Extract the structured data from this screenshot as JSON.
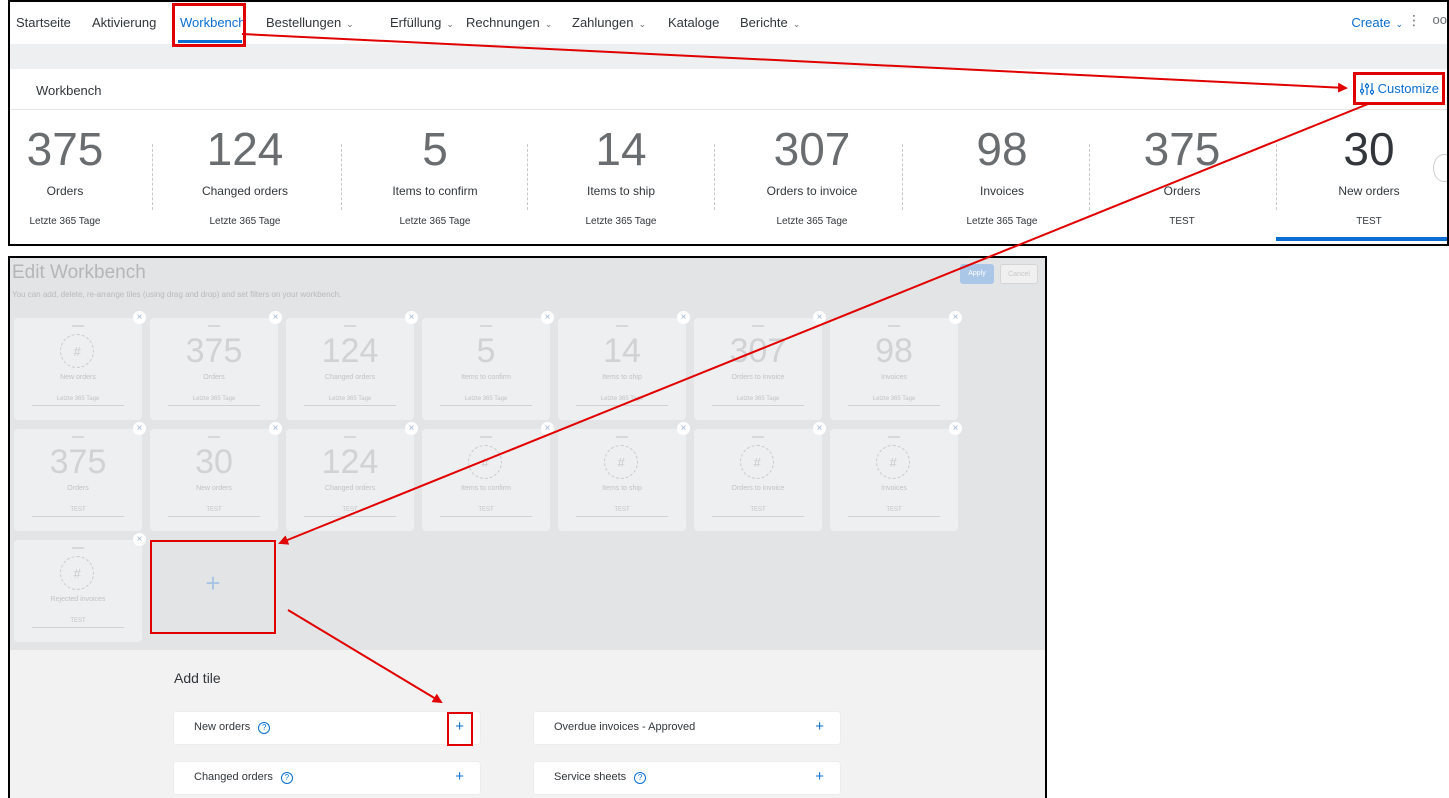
{
  "nav": {
    "items": [
      {
        "label": "Startseite",
        "dropdown": false
      },
      {
        "label": "Aktivierung",
        "dropdown": false
      },
      {
        "label": "Workbench",
        "dropdown": false,
        "active": true
      },
      {
        "label": "Bestellungen",
        "dropdown": true
      },
      {
        "label": "Erfüllung",
        "dropdown": true
      },
      {
        "label": "Rechnungen",
        "dropdown": true
      },
      {
        "label": "Zahlungen",
        "dropdown": true
      },
      {
        "label": "Kataloge",
        "dropdown": false
      },
      {
        "label": "Berichte",
        "dropdown": true
      }
    ],
    "create_label": "Create",
    "more_label": "oo"
  },
  "workbench": {
    "title": "Workbench",
    "customize_label": "Customize",
    "tiles": [
      {
        "count": "375",
        "label": "Orders",
        "period": "Letzte 365 Tage"
      },
      {
        "count": "124",
        "label": "Changed orders",
        "period": "Letzte 365 Tage"
      },
      {
        "count": "5",
        "label": "Items to confirm",
        "period": "Letzte 365 Tage"
      },
      {
        "count": "14",
        "label": "Items to ship",
        "period": "Letzte 365 Tage"
      },
      {
        "count": "307",
        "label": "Orders to invoice",
        "period": "Letzte 365 Tage"
      },
      {
        "count": "98",
        "label": "Invoices",
        "period": "Letzte 365 Tage"
      },
      {
        "count": "375",
        "label": "Orders",
        "period": "TEST"
      },
      {
        "count": "30",
        "label": "New orders",
        "period": "TEST",
        "selected": true
      }
    ]
  },
  "edit": {
    "title": "Edit Workbench",
    "description": "You can add, delete, re-arrange tiles (using drag and drop) and set filters on your workbench.",
    "apply_label": "Apply",
    "cancel_label": "Cancel",
    "placeholder_glyph": "#",
    "close_glyph": "×",
    "add_glyph": "+",
    "tiles_row1": [
      {
        "count": "",
        "label": "New orders",
        "period": "Letzte 365 Tage"
      },
      {
        "count": "375",
        "label": "Orders",
        "period": "Letzte 365 Tage"
      },
      {
        "count": "124",
        "label": "Changed orders",
        "period": "Letzte 365 Tage"
      },
      {
        "count": "5",
        "label": "Items to confirm",
        "period": "Letzte 365 Tage"
      },
      {
        "count": "14",
        "label": "Items to ship",
        "period": "Letzte 365 Tage"
      },
      {
        "count": "307",
        "label": "Orders to invoice",
        "period": "Letzte 365 Tage"
      },
      {
        "count": "98",
        "label": "Invoices",
        "period": "Letzte 365 Tage"
      }
    ],
    "tiles_row2": [
      {
        "count": "375",
        "label": "Orders",
        "period": "TEST"
      },
      {
        "count": "30",
        "label": "New orders",
        "period": "TEST"
      },
      {
        "count": "124",
        "label": "Changed orders",
        "period": "TEST"
      },
      {
        "count": "",
        "label": "Items to confirm",
        "period": "TEST"
      },
      {
        "count": "",
        "label": "Items to ship",
        "period": "TEST"
      },
      {
        "count": "",
        "label": "Orders to invoice",
        "period": "TEST"
      },
      {
        "count": "",
        "label": "Invoices",
        "period": "TEST"
      }
    ],
    "tiles_row3": [
      {
        "count": "",
        "label": "Rejected invoices",
        "period": "TEST"
      }
    ]
  },
  "add_tile": {
    "title": "Add tile",
    "help_glyph": "?",
    "rows": [
      {
        "label": "New orders",
        "help": true
      },
      {
        "label": "Overdue invoices - Approved",
        "help": false
      },
      {
        "label": "Changed orders",
        "help": true
      },
      {
        "label": "Service sheets",
        "help": true
      }
    ]
  },
  "colors": {
    "accent": "#0a6ed1",
    "highlight": "#e00000"
  }
}
